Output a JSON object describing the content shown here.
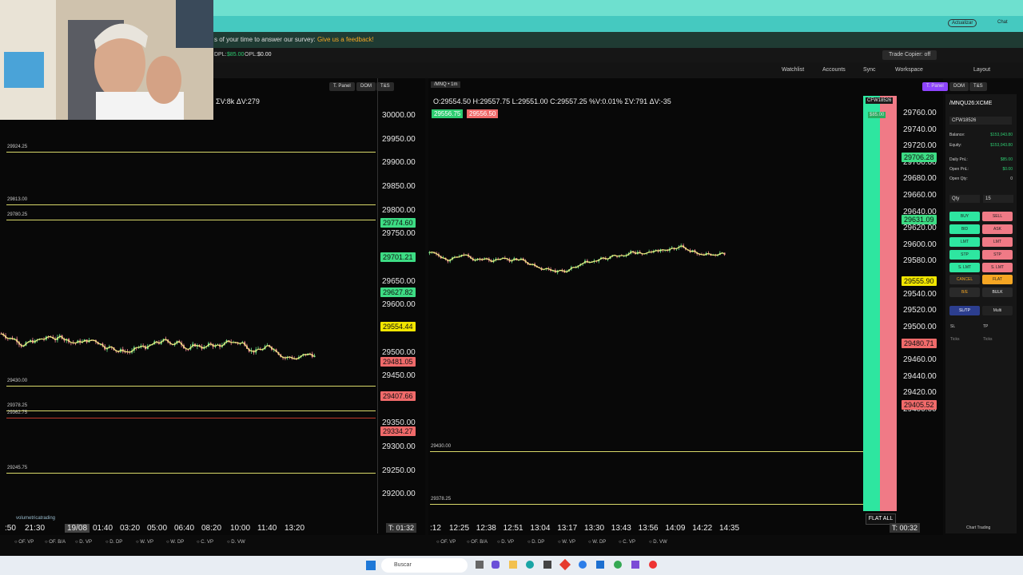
{
  "survey": {
    "text": "s of your time to answer our survey: ",
    "link": "Give us a feedback!"
  },
  "account": {
    "dpl_label": "DPL:",
    "dpl": "$85.00",
    "opl_label": "OPL:",
    "opl": "$0.00",
    "trade_copier": "Trade Copier: off"
  },
  "browser": {
    "update": "Actualizar",
    "chat": "Chat"
  },
  "toolbar": {
    "watchlist": "Watchlist",
    "accounts": "Accounts",
    "sync": "Sync",
    "workspace": "Workspace",
    "layout": "Layout",
    "tpanel": "T. Panel",
    "dom": "DOM",
    "ts": "T&S"
  },
  "left_chart": {
    "header": "ΣV:8k  ΔV:279",
    "yticks": [
      "30000.00",
      "29950.00",
      "29900.00",
      "29850.00",
      "29800.00",
      "29750.00",
      "29650.00",
      "29600.00",
      "29500.00",
      "29450.00",
      "29350.00",
      "29300.00",
      "29250.00",
      "29200.00"
    ],
    "price_labels": [
      {
        "v": "29774.60",
        "c": "#3ddc84"
      },
      {
        "v": "29701.21",
        "c": "#3ddc84"
      },
      {
        "v": "29627.82",
        "c": "#3ddc84"
      },
      {
        "v": "29554.44",
        "c": "#f2e600"
      },
      {
        "v": "29481.05",
        "c": "#f06a6a"
      },
      {
        "v": "29407.66",
        "c": "#f06a6a"
      },
      {
        "v": "29334.27",
        "c": "#f06a6a"
      }
    ],
    "levels": [
      "29924.25",
      "29813.00",
      "29780.25",
      "29430.00",
      "29378.25",
      "29362.75",
      "29245.75"
    ],
    "xticks": [
      ":50",
      "21:30",
      "19/08",
      "01:40",
      "03:20",
      "05:00",
      "06:40",
      "08:20",
      "10:00",
      "11:40",
      "13:20"
    ],
    "timer": "T: 01:32",
    "watermark": "volumetricatrading",
    "footer": [
      "OF. VP",
      "OF. B/A",
      "D. VP",
      "D. DP",
      "W. VP",
      "W. DP",
      "C. VP",
      "D. VW"
    ]
  },
  "right_chart": {
    "tab": "/MNQ",
    "tf": "1m",
    "ohlc": "O:29554.50  H:29557.75  L:29551.00  C:29557.25  %V:0.01%  ΣV:791  ΔV:-35",
    "bid": "29556.75",
    "ask": "29556.50",
    "yticks": [
      "29760.00",
      "29740.00",
      "29720.00",
      "29700.00",
      "29680.00",
      "29660.00",
      "29640.00",
      "29620.00",
      "29600.00",
      "29580.00",
      "29540.00",
      "29520.00",
      "29500.00",
      "29460.00",
      "29440.00",
      "29420.00",
      "29400.00"
    ],
    "price_labels": [
      {
        "v": "29706.28",
        "c": "#3ddc84"
      },
      {
        "v": "29631.09",
        "c": "#3ddc84"
      },
      {
        "v": "29555.90",
        "c": "#f2e600"
      },
      {
        "v": "29480.71",
        "c": "#f06a6a"
      },
      {
        "v": "29405.52",
        "c": "#f06a6a"
      }
    ],
    "levels": [
      "29430.00",
      "29378.25"
    ],
    "xticks": [
      ":12",
      "12:25",
      "12:38",
      "12:51",
      "13:04",
      "13:17",
      "13:30",
      "13:43",
      "13:56",
      "14:09",
      "14:22",
      "14:35"
    ],
    "timer": "T: 00:32",
    "account_tag": "CFW18526",
    "pnl_tag": "$85.00",
    "flat_all": "FLAT ALL",
    "footer": [
      "OF. VP",
      "OF. B/A",
      "D. VP",
      "D. DP",
      "W. VP",
      "W. DP",
      "C. VP",
      "D. VW"
    ]
  },
  "panel": {
    "symbol": "/MNQU26:XCME",
    "account": "CFW18526",
    "rows": [
      {
        "l": "Balance:",
        "v": "$153,043.80"
      },
      {
        "l": "Equity:",
        "v": "$153,043.80"
      },
      {
        "l": "Daily PnL:",
        "v": "$85.00"
      },
      {
        "l": "Open PnL:",
        "v": "$0.00"
      },
      {
        "l": "Open Qty:",
        "v": "0"
      }
    ],
    "qty_label": "Qty",
    "qty": "15",
    "buttons": [
      [
        "BUY",
        "SELL"
      ],
      [
        "BID",
        "ASK"
      ],
      [
        "LMT",
        "LMT"
      ],
      [
        "STP",
        "STP"
      ],
      [
        "S. LMT",
        "S. LMT"
      ]
    ],
    "cancel": "CANCEL",
    "flat": "FLAT",
    "be": "B/E",
    "bulk": "BULK",
    "sltp": "SL/TP",
    "multi": "Multi",
    "sl": "SL",
    "tp": "TP",
    "ticks": "Ticks",
    "chart_trading": "Chart Trading"
  },
  "taskbar": {
    "search": "Buscar"
  }
}
